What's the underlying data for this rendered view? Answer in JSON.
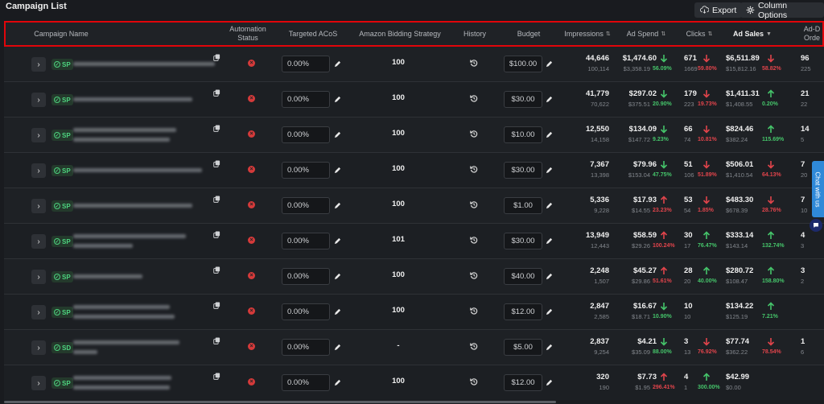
{
  "page": {
    "title": "Campaign List"
  },
  "toolbar": {
    "export_label": "Export",
    "column_options_label": "Column Options"
  },
  "columns": {
    "campaign_name": "Campaign Name",
    "automation_status": "Automation Status",
    "targeted_acos": "Targeted ACoS",
    "bidding_strategy": "Amazon Bidding Strategy",
    "history": "History",
    "budget": "Budget",
    "impressions": "Impressions",
    "ad_spend": "Ad Spend",
    "clicks": "Clicks",
    "ad_sales": "Ad Sales",
    "ad_orders": "Ad-D Orde"
  },
  "colors": {
    "up": "#45c46a",
    "down": "#e0444b",
    "highlight_border": "#e1050a"
  },
  "rows": [
    {
      "type": "SP",
      "acos": "0.00%",
      "bidding": "100",
      "budget": "$100.00",
      "impressions": "44,646",
      "impressions_prev": "100,114",
      "spend": "$1,474.60",
      "spend_prev": "$3,358.19",
      "spend_pct": "56.09%",
      "spend_dir": "down",
      "spend_good": true,
      "clicks": "671",
      "clicks_prev": "1669",
      "clicks_pct": "59.80%",
      "clicks_dir": "down",
      "sales": "$6,511.89",
      "sales_prev": "$15,812.16",
      "sales_pct": "58.82%",
      "sales_dir": "down",
      "orders": "96",
      "orders_prev": "225"
    },
    {
      "type": "SP",
      "acos": "0.00%",
      "bidding": "100",
      "budget": "$30.00",
      "impressions": "41,779",
      "impressions_prev": "70,622",
      "spend": "$297.02",
      "spend_prev": "$375.51",
      "spend_pct": "20.90%",
      "spend_dir": "down",
      "spend_good": true,
      "clicks": "179",
      "clicks_prev": "223",
      "clicks_pct": "19.73%",
      "clicks_dir": "down",
      "sales": "$1,411.31",
      "sales_prev": "$1,408.55",
      "sales_pct": "0.20%",
      "sales_dir": "up",
      "orders": "21",
      "orders_prev": "22"
    },
    {
      "type": "SP",
      "acos": "0.00%",
      "bidding": "100",
      "budget": "$10.00",
      "impressions": "12,550",
      "impressions_prev": "14,158",
      "spend": "$134.09",
      "spend_prev": "$147.72",
      "spend_pct": "9.23%",
      "spend_dir": "down",
      "spend_good": true,
      "clicks": "66",
      "clicks_prev": "74",
      "clicks_pct": "10.81%",
      "clicks_dir": "down",
      "sales": "$824.46",
      "sales_prev": "$382.24",
      "sales_pct": "115.69%",
      "sales_dir": "up",
      "orders": "14",
      "orders_prev": "5"
    },
    {
      "type": "SP",
      "acos": "0.00%",
      "bidding": "100",
      "budget": "$30.00",
      "impressions": "7,367",
      "impressions_prev": "13,398",
      "spend": "$79.96",
      "spend_prev": "$153.04",
      "spend_pct": "47.75%",
      "spend_dir": "down",
      "spend_good": true,
      "clicks": "51",
      "clicks_prev": "106",
      "clicks_pct": "51.89%",
      "clicks_dir": "down",
      "sales": "$506.01",
      "sales_prev": "$1,410.54",
      "sales_pct": "64.13%",
      "sales_dir": "down",
      "orders": "7",
      "orders_prev": "20"
    },
    {
      "type": "SP",
      "acos": "0.00%",
      "bidding": "100",
      "budget": "$1.00",
      "impressions": "5,336",
      "impressions_prev": "9,228",
      "spend": "$17.93",
      "spend_prev": "$14.55",
      "spend_pct": "23.23%",
      "spend_dir": "up",
      "spend_good": false,
      "clicks": "53",
      "clicks_prev": "54",
      "clicks_pct": "1.85%",
      "clicks_dir": "down",
      "sales": "$483.30",
      "sales_prev": "$678.39",
      "sales_pct": "28.76%",
      "sales_dir": "down",
      "orders": "7",
      "orders_prev": "10"
    },
    {
      "type": "SP",
      "acos": "0.00%",
      "bidding": "101",
      "budget": "$30.00",
      "impressions": "13,949",
      "impressions_prev": "12,443",
      "spend": "$58.59",
      "spend_prev": "$29.26",
      "spend_pct": "100.24%",
      "spend_dir": "up",
      "spend_good": false,
      "clicks": "30",
      "clicks_prev": "17",
      "clicks_pct": "76.47%",
      "clicks_dir": "up",
      "sales": "$333.14",
      "sales_prev": "$143.14",
      "sales_pct": "132.74%",
      "sales_dir": "up",
      "orders": "4",
      "orders_prev": "3"
    },
    {
      "type": "SP",
      "acos": "0.00%",
      "bidding": "100",
      "budget": "$40.00",
      "impressions": "2,248",
      "impressions_prev": "1,507",
      "spend": "$45.27",
      "spend_prev": "$29.86",
      "spend_pct": "51.61%",
      "spend_dir": "up",
      "spend_good": false,
      "clicks": "28",
      "clicks_prev": "20",
      "clicks_pct": "40.00%",
      "clicks_dir": "up",
      "sales": "$280.72",
      "sales_prev": "$108.47",
      "sales_pct": "158.80%",
      "sales_dir": "up",
      "orders": "3",
      "orders_prev": "2"
    },
    {
      "type": "SP",
      "acos": "0.00%",
      "bidding": "100",
      "budget": "$12.00",
      "impressions": "2,847",
      "impressions_prev": "2,585",
      "spend": "$16.67",
      "spend_prev": "$18.71",
      "spend_pct": "10.90%",
      "spend_dir": "down",
      "spend_good": true,
      "clicks": "10",
      "clicks_prev": "10",
      "clicks_pct": "",
      "clicks_dir": "none",
      "sales": "$134.22",
      "sales_prev": "$125.19",
      "sales_pct": "7.21%",
      "sales_dir": "up",
      "orders": "",
      "orders_prev": ""
    },
    {
      "type": "SD",
      "acos": "0.00%",
      "bidding": "-",
      "budget": "$5.00",
      "impressions": "2,837",
      "impressions_prev": "9,254",
      "spend": "$4.21",
      "spend_prev": "$35.09",
      "spend_pct": "88.00%",
      "spend_dir": "down",
      "spend_good": true,
      "clicks": "3",
      "clicks_prev": "13",
      "clicks_pct": "76.92%",
      "clicks_dir": "down",
      "sales": "$77.74",
      "sales_prev": "$362.22",
      "sales_pct": "78.54%",
      "sales_dir": "down",
      "orders": "1",
      "orders_prev": "6"
    },
    {
      "type": "SP",
      "acos": "0.00%",
      "bidding": "100",
      "budget": "$12.00",
      "impressions": "320",
      "impressions_prev": "190",
      "spend": "$7.73",
      "spend_prev": "$1.95",
      "spend_pct": "296.41%",
      "spend_dir": "up",
      "spend_good": false,
      "clicks": "4",
      "clicks_prev": "1",
      "clicks_pct": "300.00%",
      "clicks_dir": "up",
      "sales": "$42.99",
      "sales_prev": "$0.00",
      "sales_pct": "",
      "sales_dir": "none",
      "orders": "",
      "orders_prev": ""
    }
  ],
  "chat": {
    "label": "Chat with us"
  }
}
